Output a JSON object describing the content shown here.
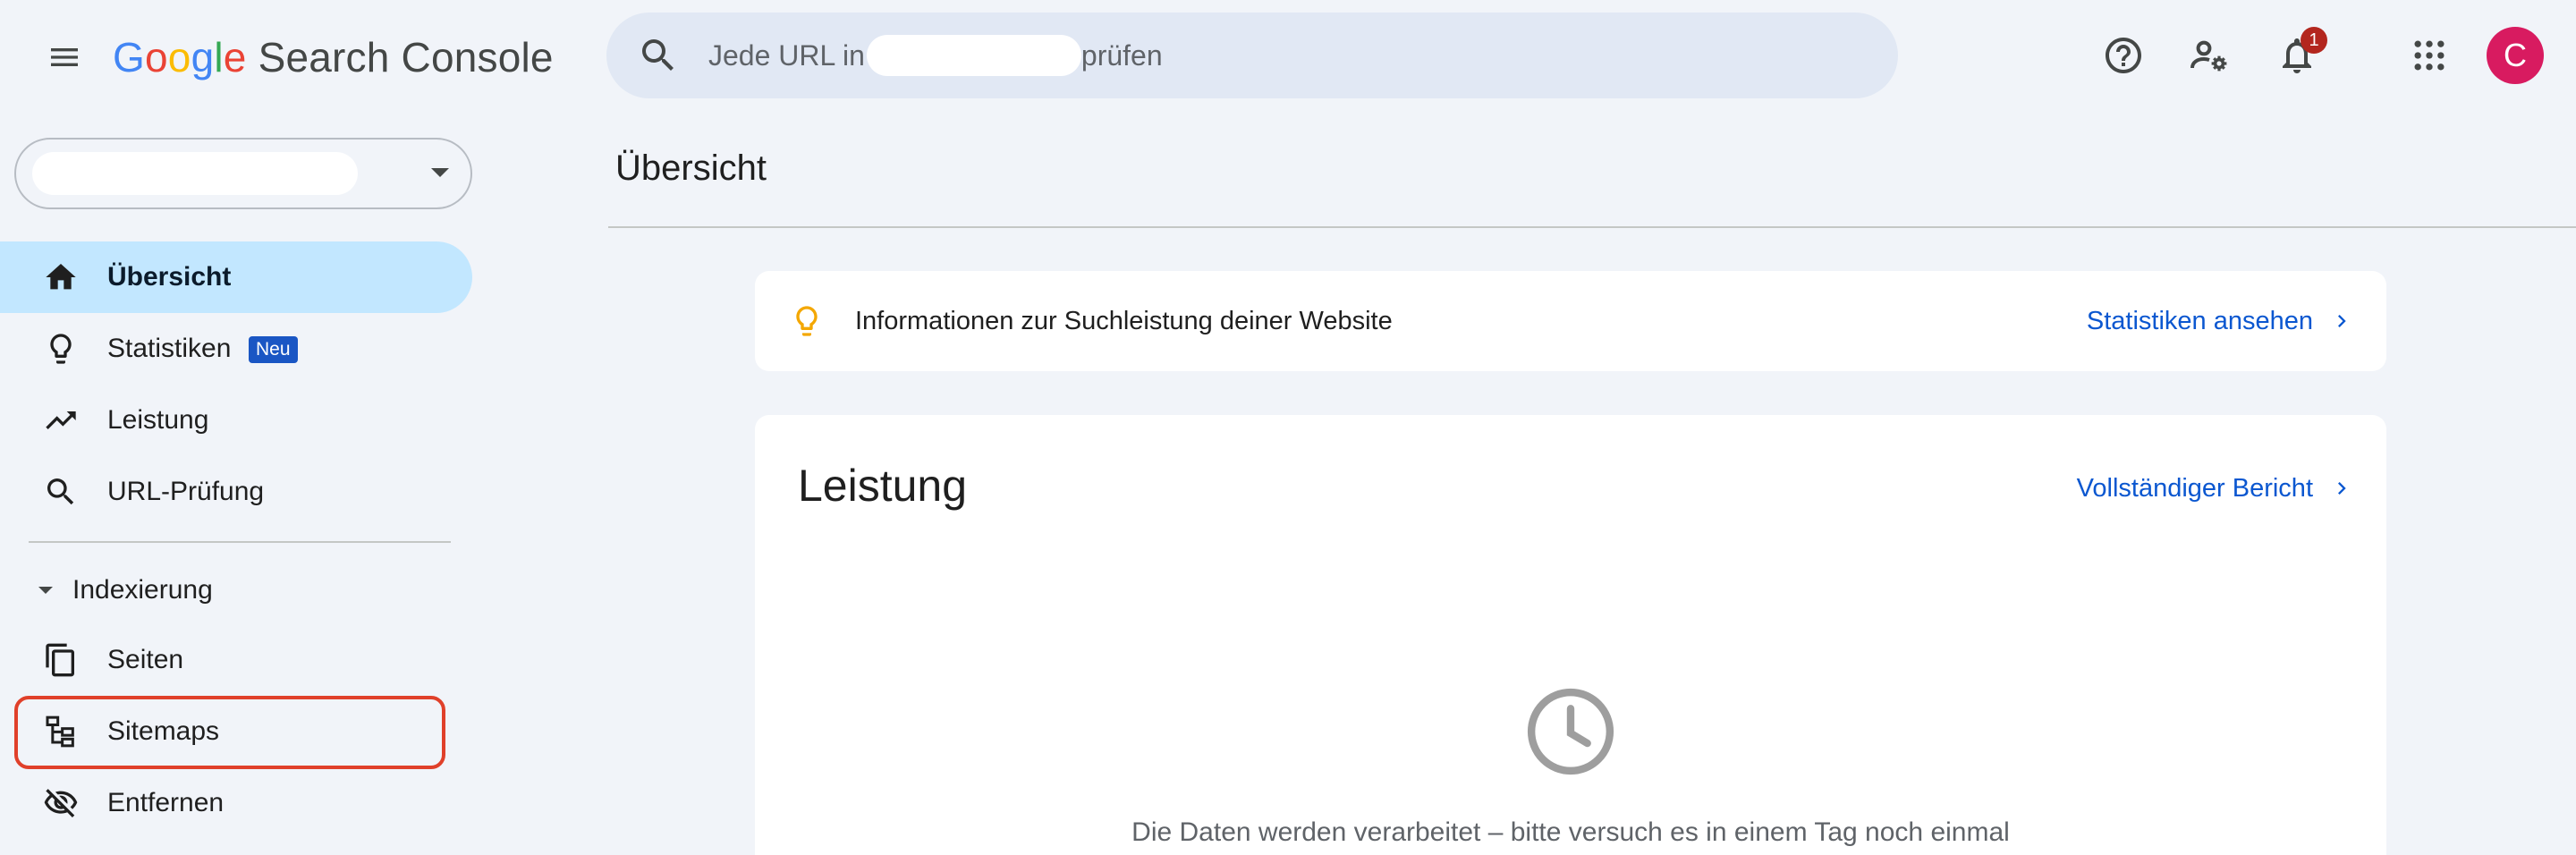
{
  "header": {
    "logo": {
      "g1": "G",
      "g2": "o",
      "g3": "o",
      "g4": "g",
      "g5": "l",
      "g6": "e",
      "product": "Search Console"
    },
    "search": {
      "text_before": "Jede URL in",
      "text_after": "prüfen"
    },
    "notifications_count": "1",
    "avatar_initial": "C",
    "icons": [
      "menu-icon",
      "search-icon",
      "help-icon",
      "manage-users-icon",
      "notifications-icon",
      "apps-grid-icon"
    ]
  },
  "sidebar": {
    "items": [
      {
        "label": "Übersicht",
        "icon": "home-icon",
        "active": true
      },
      {
        "label": "Statistiken",
        "icon": "lightbulb-icon",
        "badge": "Neu"
      },
      {
        "label": "Leistung",
        "icon": "trending-up-icon"
      },
      {
        "label": "URL-Prüfung",
        "icon": "search-icon"
      }
    ],
    "section": {
      "label": "Indexierung",
      "icon": "caret-down-icon"
    },
    "section_items": [
      {
        "label": "Seiten",
        "icon": "pages-icon"
      },
      {
        "label": "Sitemaps",
        "icon": "sitemap-icon",
        "highlighted": true
      },
      {
        "label": "Entfernen",
        "icon": "visibility-off-icon"
      }
    ]
  },
  "main": {
    "title": "Übersicht",
    "insight": {
      "text": "Informationen zur Suchleistung deiner Website",
      "link": "Statistiken ansehen"
    },
    "performance": {
      "title": "Leistung",
      "link": "Vollständiger Bericht",
      "message": "Die Daten werden verarbeitet – bitte versuch es in einem Tag noch einmal"
    }
  },
  "colors": {
    "background": "#f1f4f9",
    "active_nav": "#c2e7ff",
    "link": "#0b57d0",
    "badge_new": "#1a56c4",
    "notification_badge": "#b3261e",
    "avatar": "#d81b60",
    "highlight_border": "#e0402a"
  }
}
